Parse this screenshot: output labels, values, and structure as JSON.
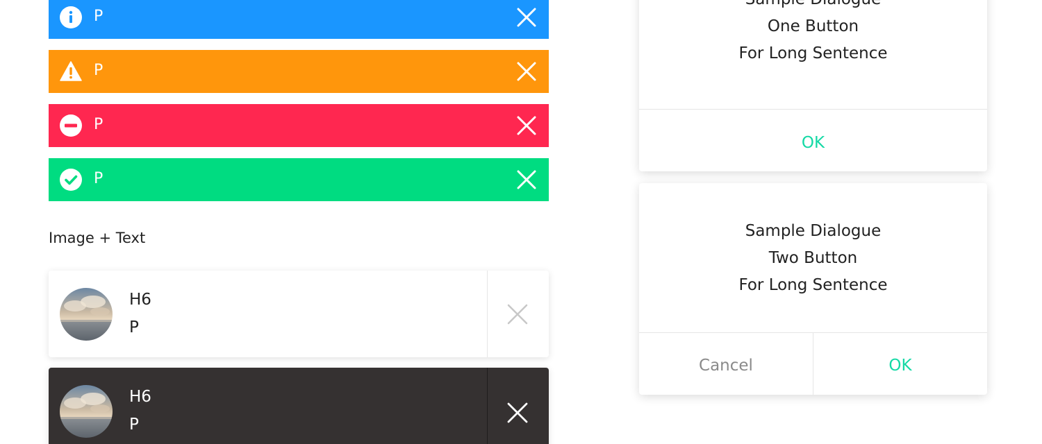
{
  "alerts": [
    {
      "type": "info",
      "icon": "info-icon",
      "text": "P",
      "color": "#1a96ff"
    },
    {
      "type": "warning",
      "icon": "warning-icon",
      "text": "P",
      "color": "#ff960c"
    },
    {
      "type": "error",
      "icon": "minus-circle-icon",
      "text": "P",
      "color": "#ff2750"
    },
    {
      "type": "success",
      "icon": "check-circle-icon",
      "text": "P",
      "color": "#00dc81"
    }
  ],
  "section_label": "Image + Text",
  "cards": [
    {
      "theme": "light",
      "title": "H6",
      "body": "P",
      "background": "#ffffff"
    },
    {
      "theme": "dark",
      "title": "H6",
      "body": "P",
      "background": "#353131"
    }
  ],
  "dialog_one": {
    "lines": [
      "Sample Dialogue",
      "One Button",
      "For Long Sentence"
    ],
    "ok_label": "OK"
  },
  "dialog_two": {
    "lines": [
      "Sample Dialogue",
      "Two Button",
      "For Long Sentence"
    ],
    "cancel_label": "Cancel",
    "ok_label": "OK"
  },
  "colors": {
    "accent": "#14d9a5",
    "muted": "#8a8a8a"
  }
}
